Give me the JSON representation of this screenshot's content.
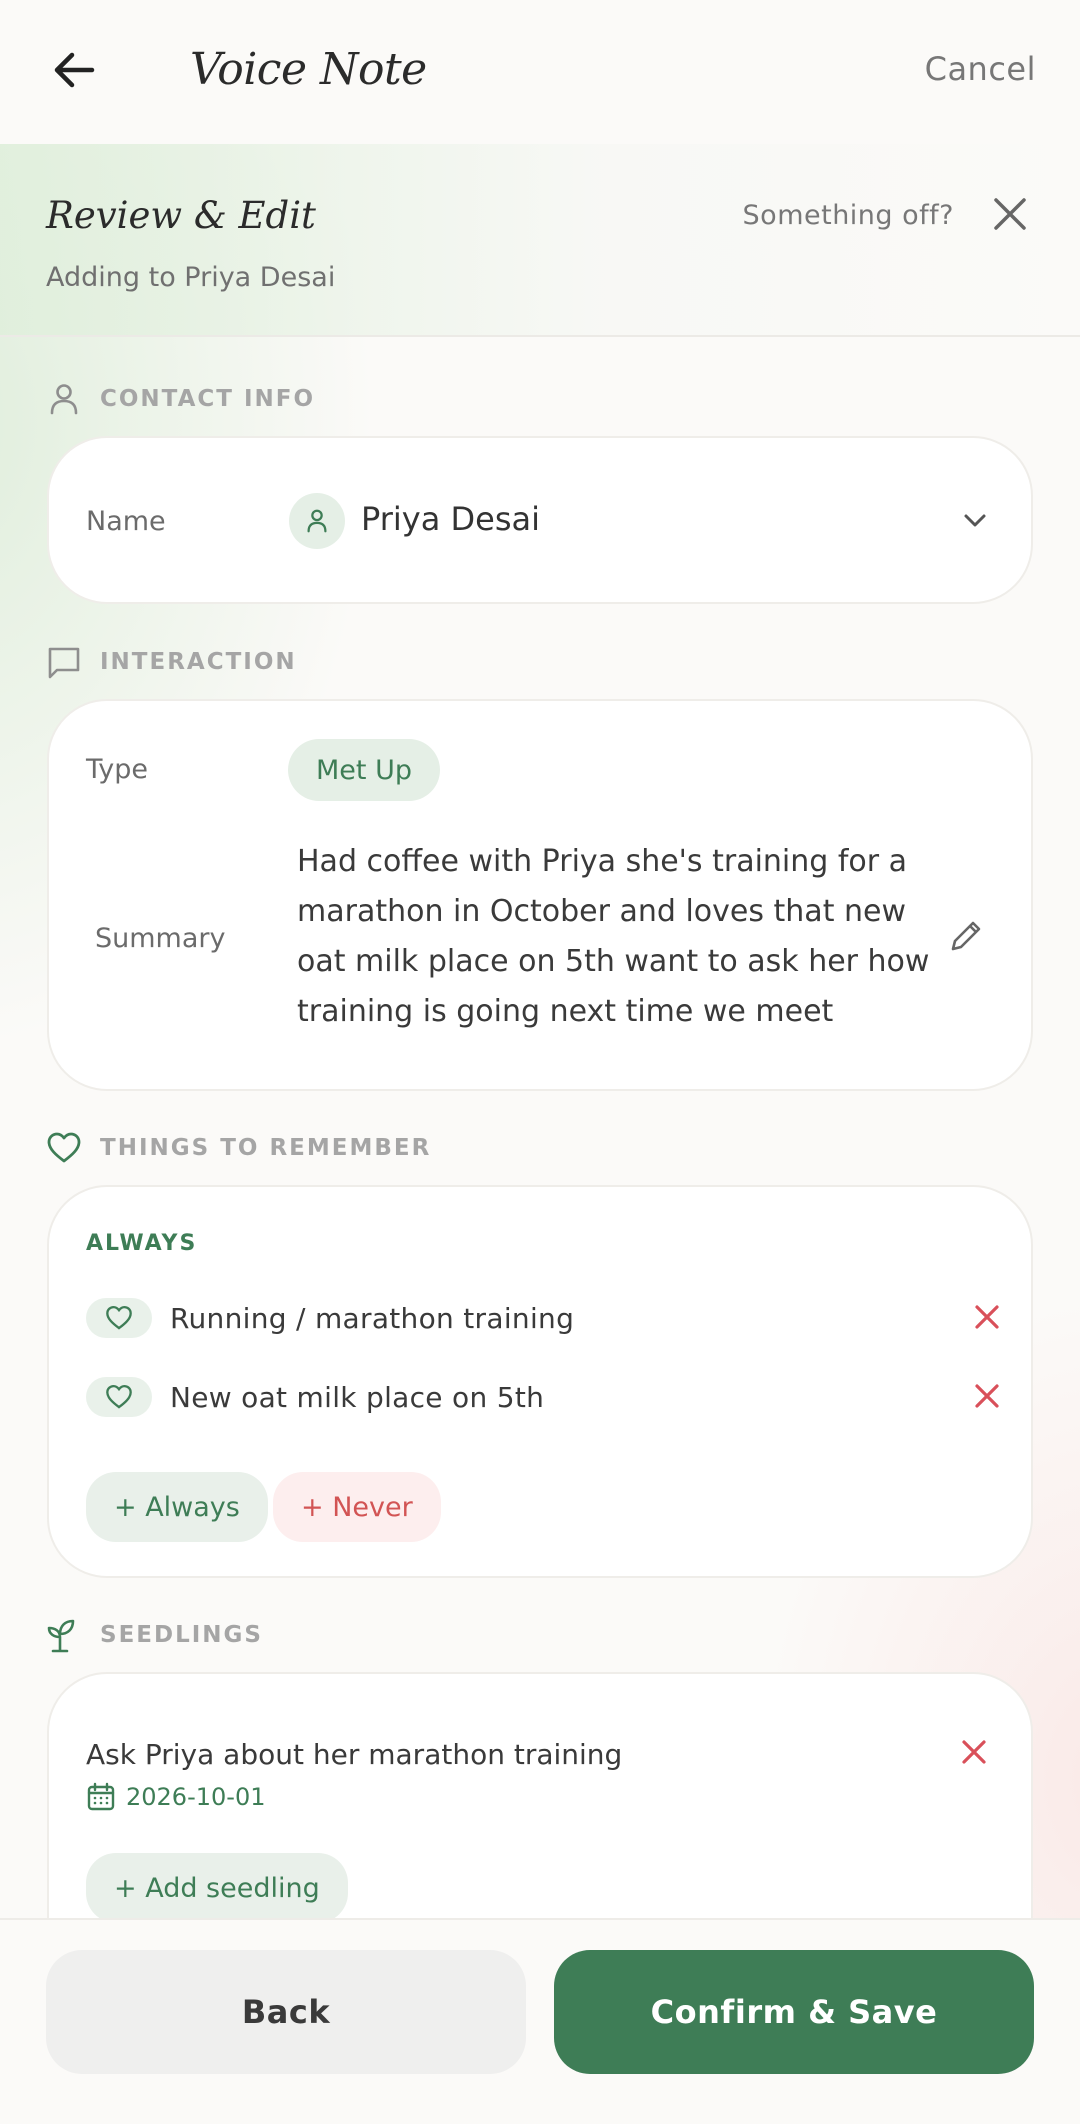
{
  "header": {
    "title": "Voice Note",
    "cancel_label": "Cancel",
    "back_icon": "arrow-left-icon"
  },
  "review": {
    "title": "Review & Edit",
    "subtitle": "Adding to Priya Desai",
    "something_off_label": "Something off?",
    "close_icon": "close-icon"
  },
  "contact_section": {
    "label": "CONTACT INFO",
    "icon": "person-icon",
    "name_label": "Name",
    "name_value": "Priya Desai"
  },
  "interaction_section": {
    "label": "INTERACTION",
    "icon": "chat-bubble-icon",
    "type_label": "Type",
    "type_value": "Met Up",
    "summary_label": "Summary",
    "summary_value": "Had coffee with Priya she's training for a marathon in October and loves that new oat milk place on 5th want to ask her how training is going next time we meet"
  },
  "remember_section": {
    "label": "THINGS TO REMEMBER",
    "icon": "heart-icon",
    "always_heading": "ALWAYS",
    "items": [
      {
        "text": "Running / marathon training"
      },
      {
        "text": "New oat milk place on 5th"
      }
    ],
    "add_always_label": "+ Always",
    "add_never_label": "+ Never"
  },
  "seedlings_section": {
    "label": "SEEDLINGS",
    "icon": "sprout-icon",
    "items": [
      {
        "text": "Ask Priya about her marathon training",
        "date": "2026-10-01"
      }
    ],
    "add_label": "+ Add seedling"
  },
  "footer": {
    "back_label": "Back",
    "confirm_label": "Confirm & Save"
  },
  "colors": {
    "accent_green": "#3e7d56",
    "remove_red": "#d9505a",
    "pill_green_bg": "#e5efe6",
    "pill_red_bg": "#fdeeee"
  }
}
